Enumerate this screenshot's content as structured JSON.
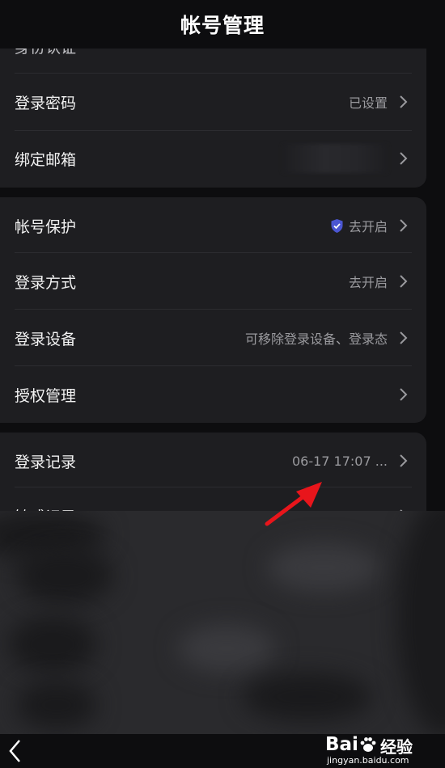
{
  "header": {
    "title": "帐号管理"
  },
  "card1": {
    "cut_row_label": "身份认证",
    "rows": [
      {
        "label": "登录密码",
        "value": "已设置"
      },
      {
        "label": "绑定邮箱",
        "value": ""
      }
    ]
  },
  "card2": {
    "rows": [
      {
        "label": "帐号保护",
        "value": "去开启"
      },
      {
        "label": "登录方式",
        "value": "去开启"
      },
      {
        "label": "登录设备",
        "value": "可移除登录设备、登录态"
      },
      {
        "label": "授权管理",
        "value": ""
      }
    ]
  },
  "card3": {
    "rows": [
      {
        "label": "登录记录",
        "value": "06-17 17:07 ..."
      },
      {
        "label": "敏感记录",
        "value": ""
      }
    ]
  },
  "watermark": {
    "brand": "Bai",
    "suffix": "经验",
    "url": "jingyan.baidu.com"
  },
  "icons": {
    "chevron": "chevron-right-icon",
    "shield": "shield-check-icon",
    "back": "back-arrow-icon",
    "annotation": "red-arrow-annotation"
  },
  "colors": {
    "accent_shield": "#4b56d2",
    "annotation": "#e8151b"
  }
}
